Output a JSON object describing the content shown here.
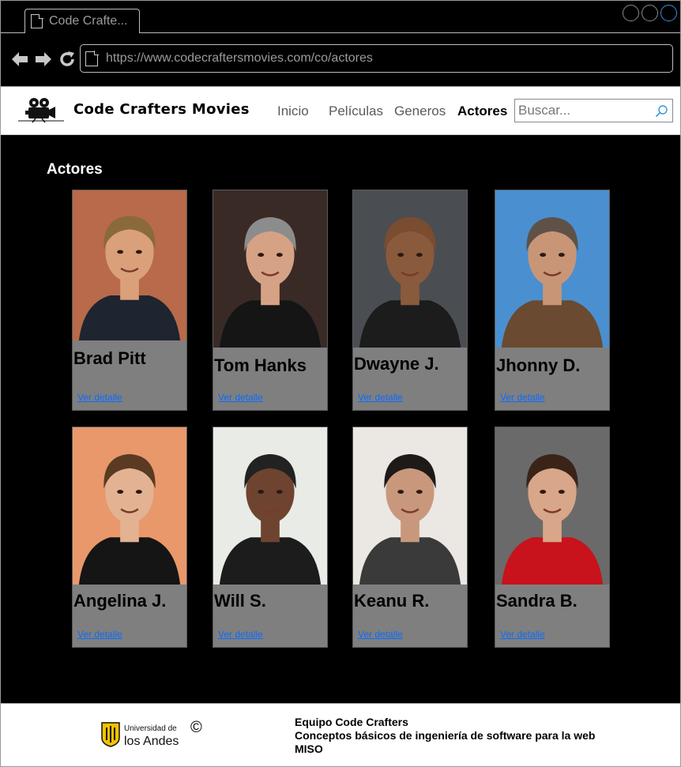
{
  "browser": {
    "tab_title": "Code Crafte...",
    "url": "https://www.codecraftersmovies.com/co/actores"
  },
  "header": {
    "brand": "Code Crafters Movies",
    "nav": [
      "Inicio",
      "Películas",
      "Generos",
      "Actores"
    ],
    "active_nav": "Actores",
    "search_placeholder": "Buscar..."
  },
  "main": {
    "title": "Actores",
    "detail_link": "Ver detalle",
    "actors": [
      {
        "name": "Brad Pitt",
        "bg": "#b86a4a",
        "skin": "#d9a07a",
        "hair": "#8a6a3a",
        "shirt": "#1e2430"
      },
      {
        "name": "Tom Hanks",
        "bg": "#3a2a25",
        "skin": "#d6a285",
        "hair": "#8c8c8c",
        "shirt": "#151515"
      },
      {
        "name": "Dwayne J.",
        "bg": "#4a4e52",
        "skin": "#8a5a3c",
        "hair": "#7a4c30",
        "shirt": "#1c1c1c"
      },
      {
        "name": "Jhonny D.",
        "bg": "#4a8fd0",
        "skin": "#c89676",
        "hair": "#5e5248",
        "shirt": "#6a4a30"
      },
      {
        "name": "Angelina J.",
        "bg": "#e8986a",
        "skin": "#e3b293",
        "hair": "#5a3a22",
        "shirt": "#151515"
      },
      {
        "name": "Will S.",
        "bg": "#e9ece6",
        "skin": "#6e4430",
        "hair": "#222222",
        "shirt": "#1c1c1c"
      },
      {
        "name": "Keanu R.",
        "bg": "#ebe7e2",
        "skin": "#c9987c",
        "hair": "#1e1a18",
        "shirt": "#3a3a3a"
      },
      {
        "name": "Sandra B.",
        "bg": "#6a6a6a",
        "skin": "#d8a688",
        "hair": "#3a2418",
        "shirt": "#c8121c"
      }
    ]
  },
  "footer": {
    "copyright": "©",
    "uni_line1": "Universidad de",
    "uni_line2": "los Andes",
    "team": "Equipo Code Crafters",
    "course": "Conceptos básicos de ingeniería de software para la web",
    "program": "MISO"
  }
}
